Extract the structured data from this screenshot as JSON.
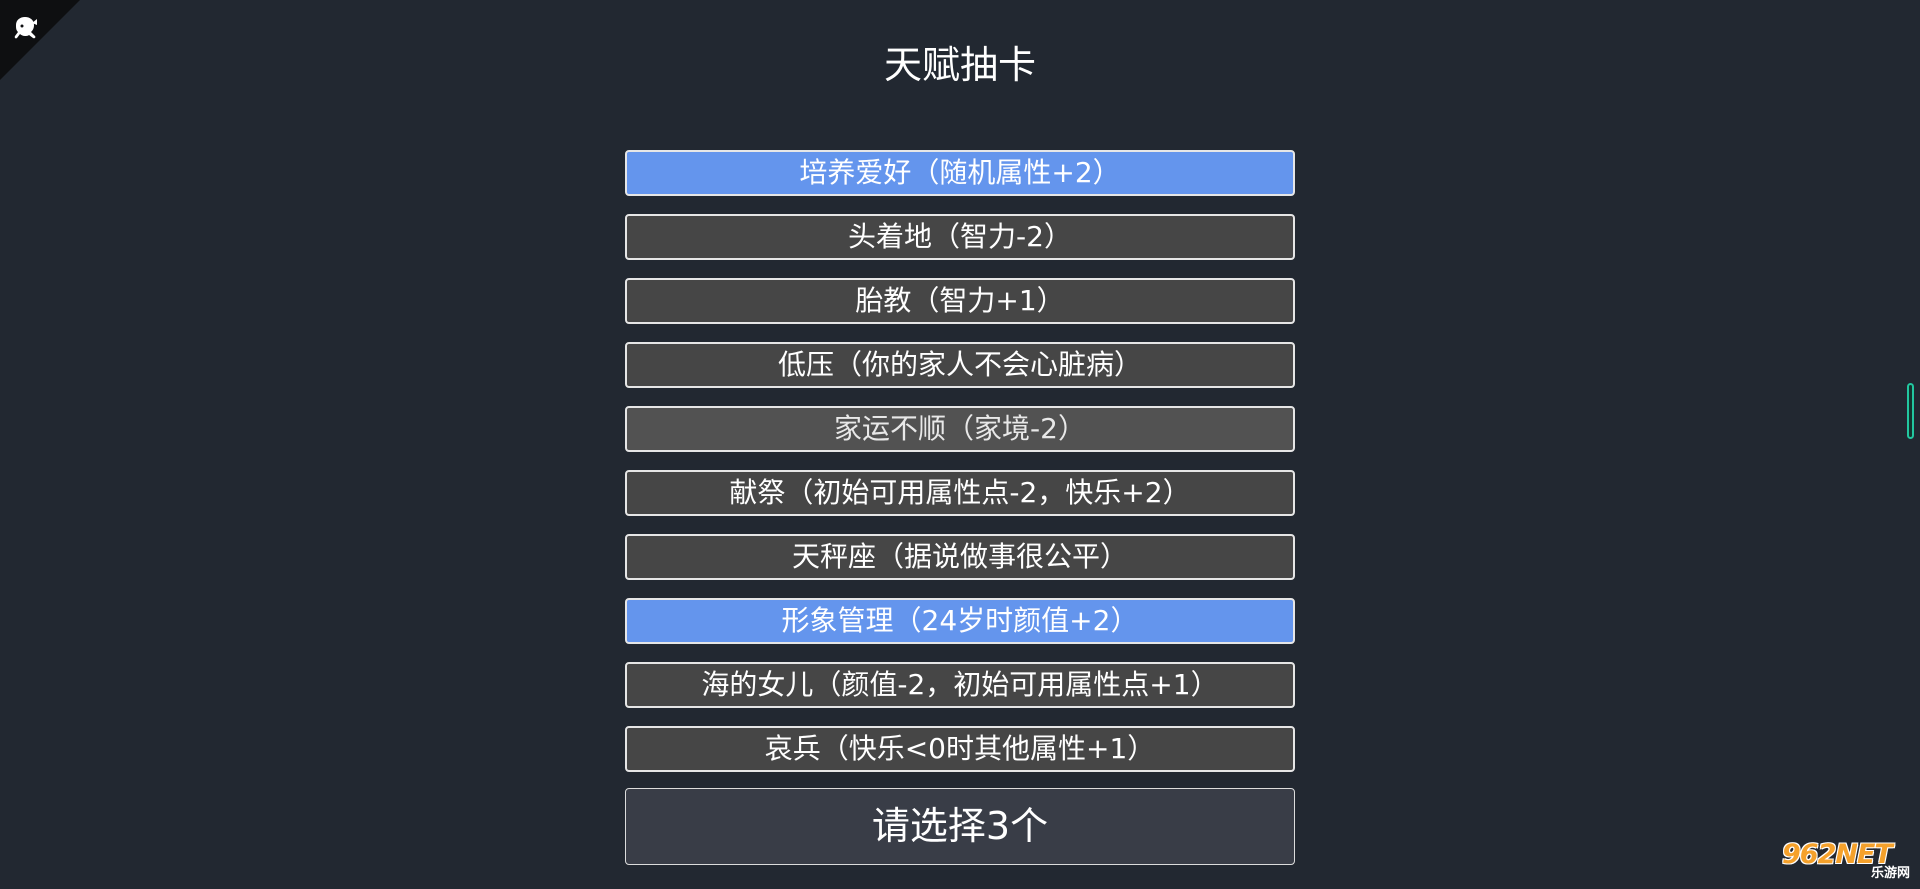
{
  "title": "天赋抽卡",
  "talents": [
    {
      "label": "培养爱好（随机属性+2）",
      "selected": true
    },
    {
      "label": "头着地（智力-2）",
      "selected": false
    },
    {
      "label": "胎教（智力+1）",
      "selected": false
    },
    {
      "label": "低压（你的家人不会心脏病）",
      "selected": false
    },
    {
      "label": "家运不顺（家境-2）",
      "selected": false
    },
    {
      "label": "献祭（初始可用属性点-2，快乐+2）",
      "selected": false
    },
    {
      "label": "天秤座（据说做事很公平）",
      "selected": false
    },
    {
      "label": "形象管理（24岁时颜值+2）",
      "selected": true
    },
    {
      "label": "海的女儿（颜值-2，初始可用属性点+1）",
      "selected": false
    },
    {
      "label": "哀兵（快乐<0时其他属性+1）",
      "selected": false
    }
  ],
  "confirm_label": "请选择3个",
  "colors": {
    "background": "#222831",
    "selected": "#6495ed",
    "unselected": "#464646",
    "confirm": "#393d47"
  },
  "corner_icon": "github-octocat-icon",
  "watermark": {
    "brand": "962NET",
    "sub": "乐游网"
  }
}
